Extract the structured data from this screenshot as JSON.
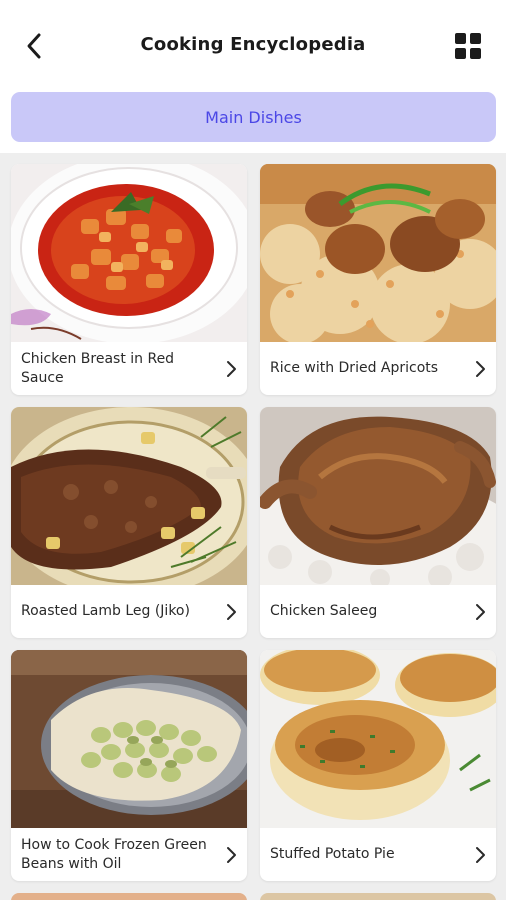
{
  "header": {
    "title": "Cooking Encyclopedia",
    "back_icon": "chevron-left-icon",
    "view_toggle_icon": "grid-view-icon"
  },
  "category": {
    "label": "Main Dishes",
    "accent_bg": "#c9c8f8",
    "accent_text": "#4b47e6"
  },
  "recipes": [
    {
      "title": "Chicken Breast in Red Sauce",
      "image": "chicken-in-tomato-sauce"
    },
    {
      "title": "Rice with Dried Apricots",
      "image": "rice-with-meat"
    },
    {
      "title": "Roasted Lamb Leg (Jiko)",
      "image": "roasted-lamb-leg"
    },
    {
      "title": "Chicken Saleeg",
      "image": "chicken-on-rice"
    },
    {
      "title": "How to Cook Frozen Green Beans with Oil",
      "image": "fava-beans-bowl"
    },
    {
      "title": "Stuffed Potato Pie",
      "image": "potato-patties"
    }
  ]
}
